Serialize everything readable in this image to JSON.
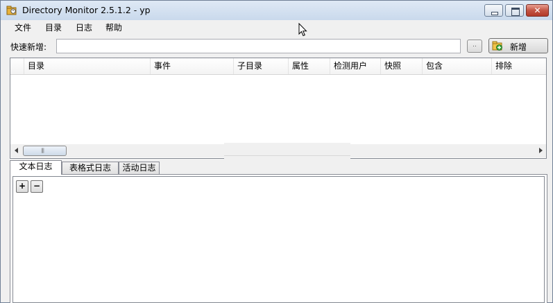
{
  "window": {
    "title": "Directory Monitor 2.5.1.2 - yp",
    "close_glyph": "✕"
  },
  "menu": {
    "items": [
      "文件",
      "目录",
      "日志",
      "帮助"
    ]
  },
  "quick_add": {
    "label": "快速新增:",
    "value": "",
    "browse_label": "..",
    "add_button_label": "新增",
    "add_icon": "folder-add-icon"
  },
  "grid": {
    "columns": [
      "目录",
      "事件",
      "子目录",
      "属性",
      "检测用户",
      "快照",
      "包含",
      "排除"
    ],
    "rows": []
  },
  "tabs": {
    "items": [
      "文本日志",
      "表格式日志",
      "活动日志"
    ],
    "active": "文本日志"
  },
  "log_toolbar": {
    "plus_label": "+",
    "minus_label": "−"
  },
  "colors": {
    "window_bg": "#f0f0f0",
    "titlebar": "#c9d9ec",
    "close_button": "#c45545"
  }
}
